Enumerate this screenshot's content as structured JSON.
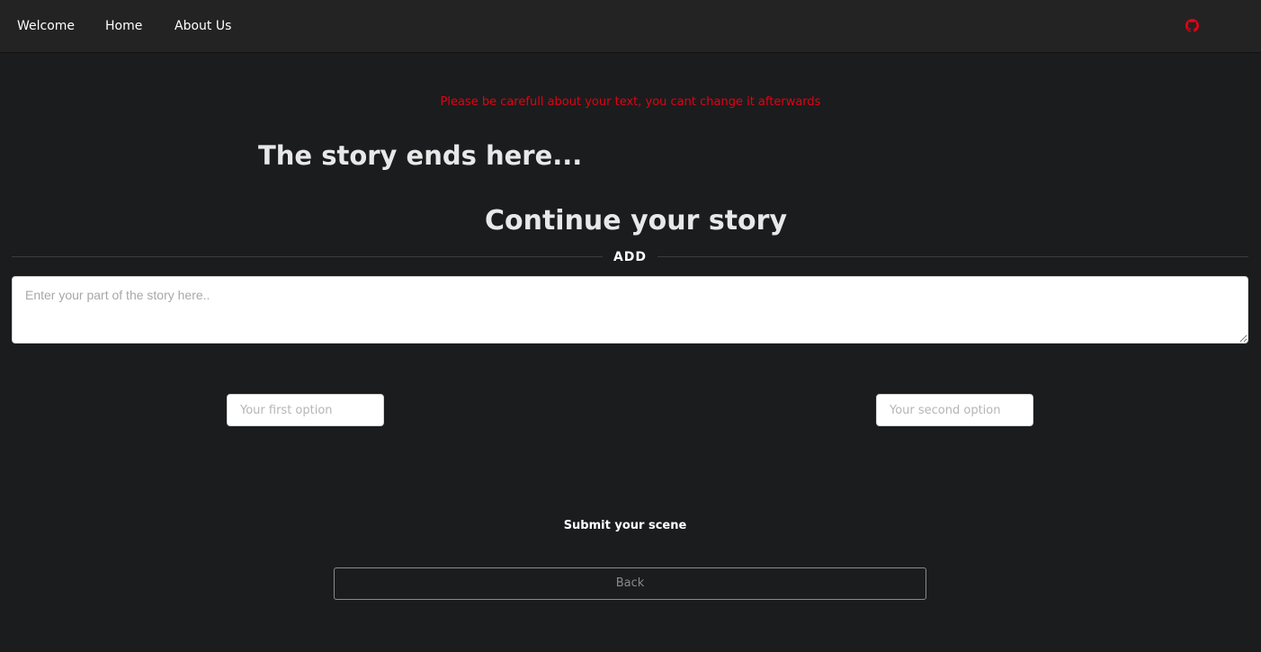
{
  "nav": {
    "items": [
      {
        "label": "Welcome"
      },
      {
        "label": "Home"
      },
      {
        "label": "About Us"
      }
    ],
    "github_icon": "github-icon",
    "github_color": "#e60012"
  },
  "warning": {
    "text": "Please be carefull about your text, you cant change it afterwards",
    "color": "#e60012"
  },
  "story": {
    "end_text": "The story ends here..."
  },
  "continue": {
    "title": "Continue your story",
    "divider_label": "ADD",
    "textarea_placeholder": "Enter your part of the story here..",
    "textarea_value": ""
  },
  "options": {
    "first_placeholder": "Your first option",
    "first_value": "",
    "second_placeholder": "Your second option",
    "second_value": ""
  },
  "actions": {
    "submit_label": "Submit your scene",
    "back_label": "Back"
  }
}
